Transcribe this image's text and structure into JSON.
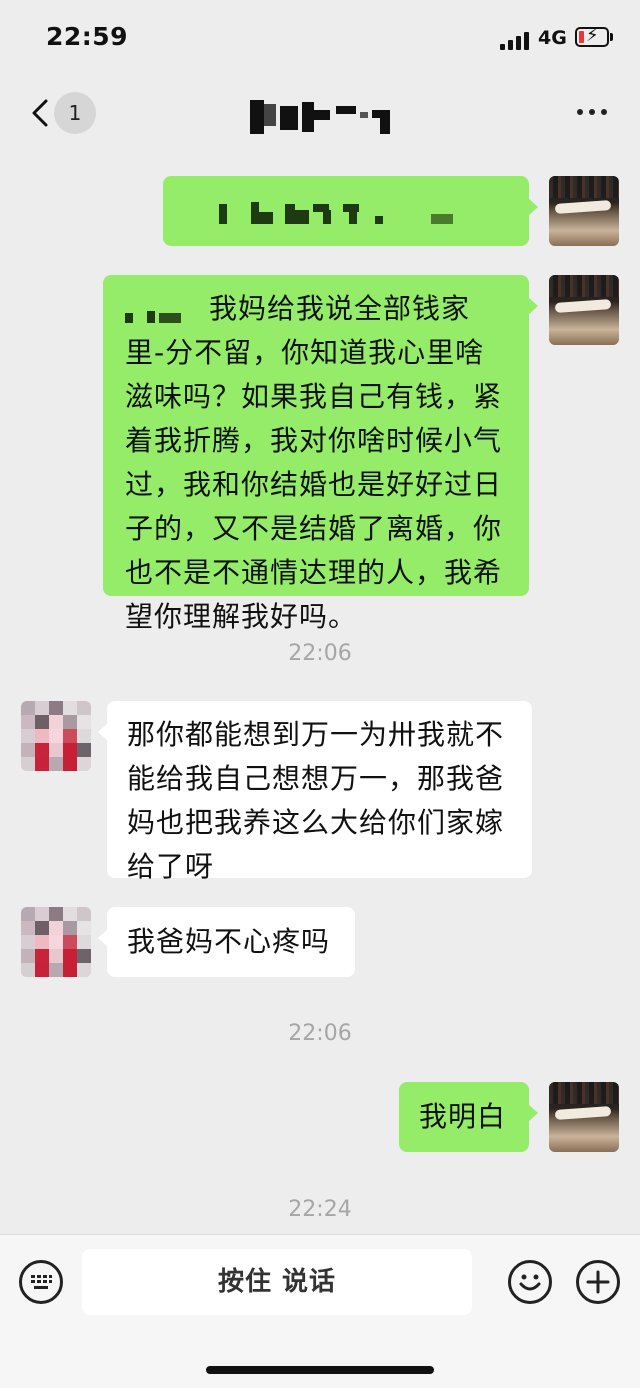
{
  "status_bar": {
    "time": "22:59",
    "network": "4G"
  },
  "nav": {
    "unread_count": "1"
  },
  "messages": [
    {
      "side": "right",
      "text": ""
    },
    {
      "side": "right",
      "text": "我妈给我说全部钱家里-分不留，你知道我心里啥滋味吗？如果我自己有钱，紧着我折腾，我对你啥时候小气过，我和你结婚也是好好过日子的，又不是结婚了离婚，你也不是不通情达理的人，我希望你理解我好吗。"
    },
    {
      "side": "left",
      "text": "那你都能想到万一为卅我就不能给我自己想想万一，那我爸妈也把我养这么大给你们家嫁给了呀"
    },
    {
      "side": "left",
      "text": "我爸妈不心疼吗"
    },
    {
      "side": "right",
      "text": "我明白"
    }
  ],
  "timestamps": [
    "22:06",
    "22:06",
    "22:24"
  ],
  "input_bar": {
    "voice_label": "按住 说话"
  },
  "colors": {
    "bubble_self": "#95ec69",
    "bubble_other": "#ffffff",
    "background": "#ededed"
  }
}
